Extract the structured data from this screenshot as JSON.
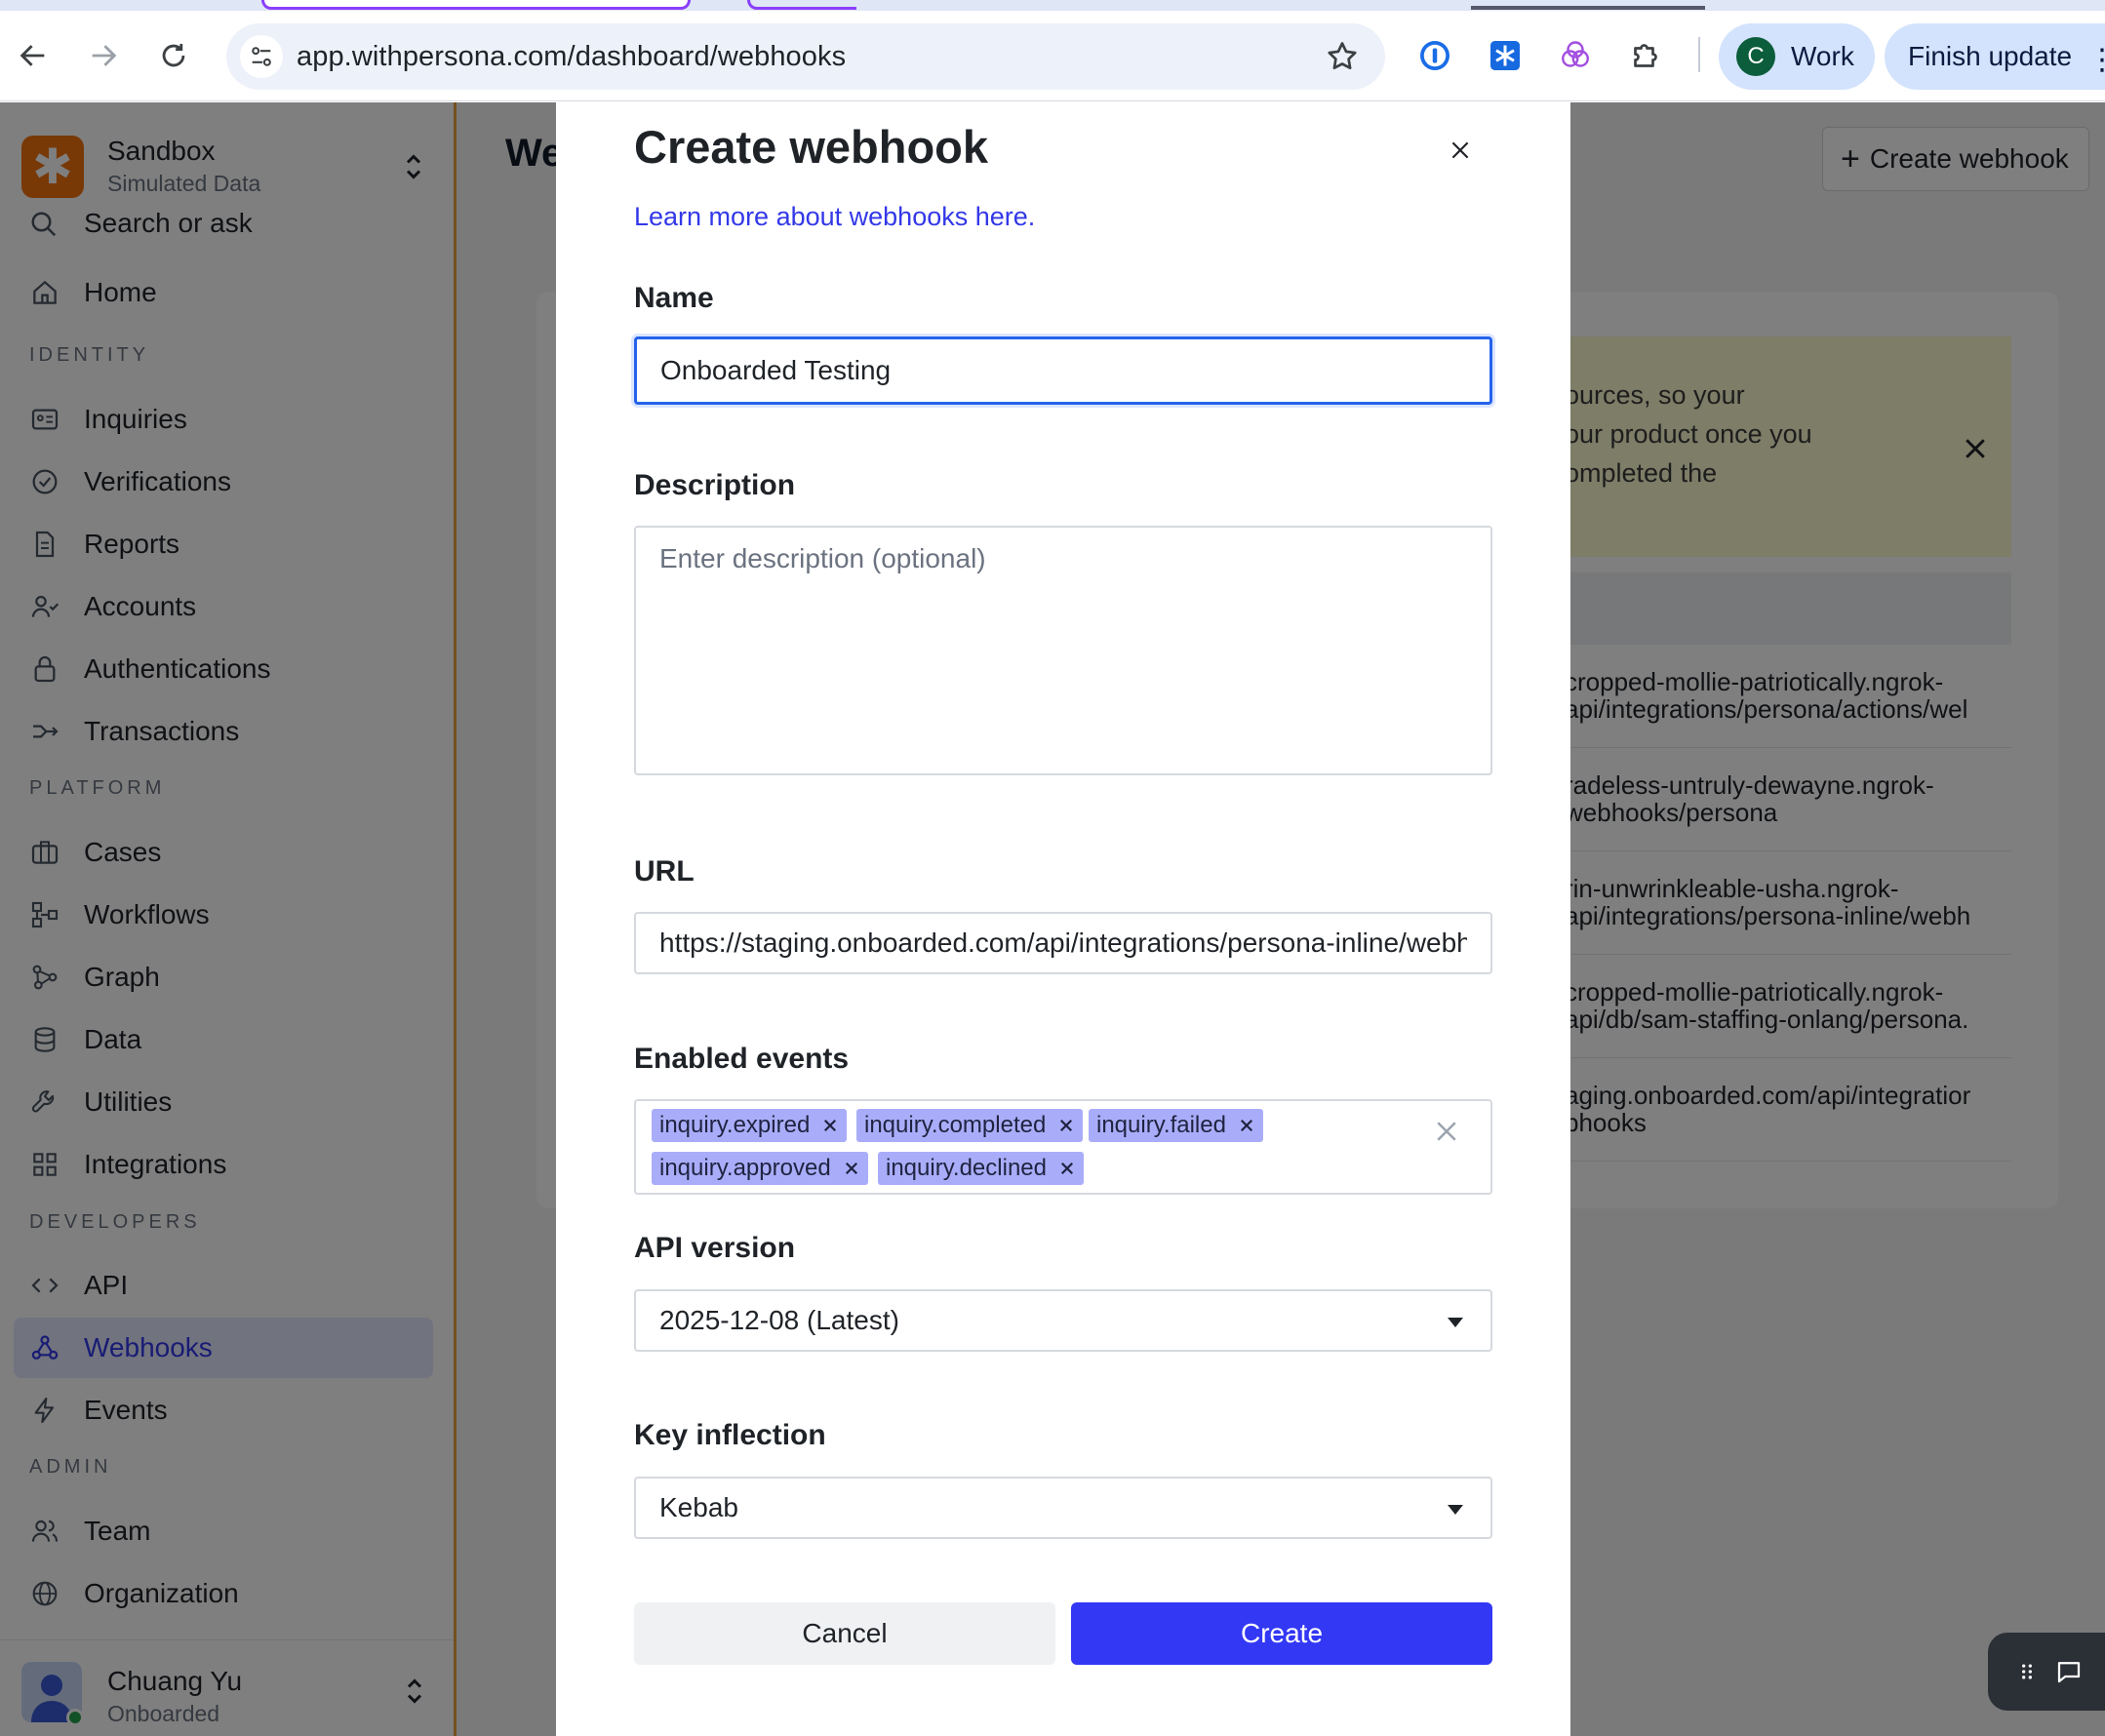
{
  "browser": {
    "url": "app.withpersona.com/dashboard/webhooks",
    "profile_initial": "C",
    "profile_label": "Work",
    "update_label": "Finish update"
  },
  "sidebar": {
    "workspace_name": "Sandbox",
    "workspace_sub": "Simulated Data",
    "search_label": "Search or ask",
    "home_label": "Home",
    "sections": {
      "identity": "IDENTITY",
      "platform": "PLATFORM",
      "developers": "DEVELOPERS",
      "admin": "ADMIN"
    },
    "items": {
      "inquiries": "Inquiries",
      "verifications": "Verifications",
      "reports": "Reports",
      "accounts": "Accounts",
      "authentications": "Authentications",
      "transactions": "Transactions",
      "cases": "Cases",
      "workflows": "Workflows",
      "graph": "Graph",
      "data": "Data",
      "utilities": "Utilities",
      "integrations": "Integrations",
      "api": "API",
      "webhooks": "Webhooks",
      "events": "Events",
      "team": "Team",
      "organization": "Organization"
    },
    "user": {
      "name": "Chuang Yu",
      "org": "Onboarded"
    }
  },
  "main": {
    "title_partial": "We",
    "create_button": "Create webhook",
    "banner_lines": [
      "ources, so your",
      "our product once you",
      "ompleted the"
    ],
    "rows": [
      [
        "cropped-mollie-patriotically.ngrok-",
        "api/integrations/persona/actions/wel"
      ],
      [
        "radeless-untruly-dewayne.ngrok-",
        "webhooks/persona"
      ],
      [
        "rin-unwrinkleable-usha.ngrok-",
        "api/integrations/persona-inline/webh"
      ],
      [
        "cropped-mollie-patriotically.ngrok-",
        "api/db/sam-staffing-onlang/persona."
      ],
      [
        "aging.onboarded.com/api/integratior",
        "bhooks"
      ]
    ]
  },
  "modal": {
    "title": "Create webhook",
    "learn_more": "Learn more about webhooks here.",
    "name_label": "Name",
    "name_value": "Onboarded Testing",
    "description_label": "Description",
    "description_placeholder": "Enter description (optional)",
    "url_label": "URL",
    "url_value": "https://staging.onboarded.com/api/integrations/persona-inline/webhooks",
    "events_label": "Enabled events",
    "events": [
      "inquiry.expired",
      "inquiry.completed",
      "inquiry.failed",
      "inquiry.approved",
      "inquiry.declined"
    ],
    "api_version_label": "API version",
    "api_version_value": "2025-12-08 (Latest)",
    "key_inflection_label": "Key inflection",
    "key_inflection_value": "Kebab",
    "cancel_label": "Cancel",
    "create_label": "Create"
  },
  "colors": {
    "accent": "#3338f5",
    "link": "#3338e8",
    "tag_bg": "#a9adf9",
    "focus_border": "#2563eb",
    "workspace_logo": "#f1730f"
  }
}
